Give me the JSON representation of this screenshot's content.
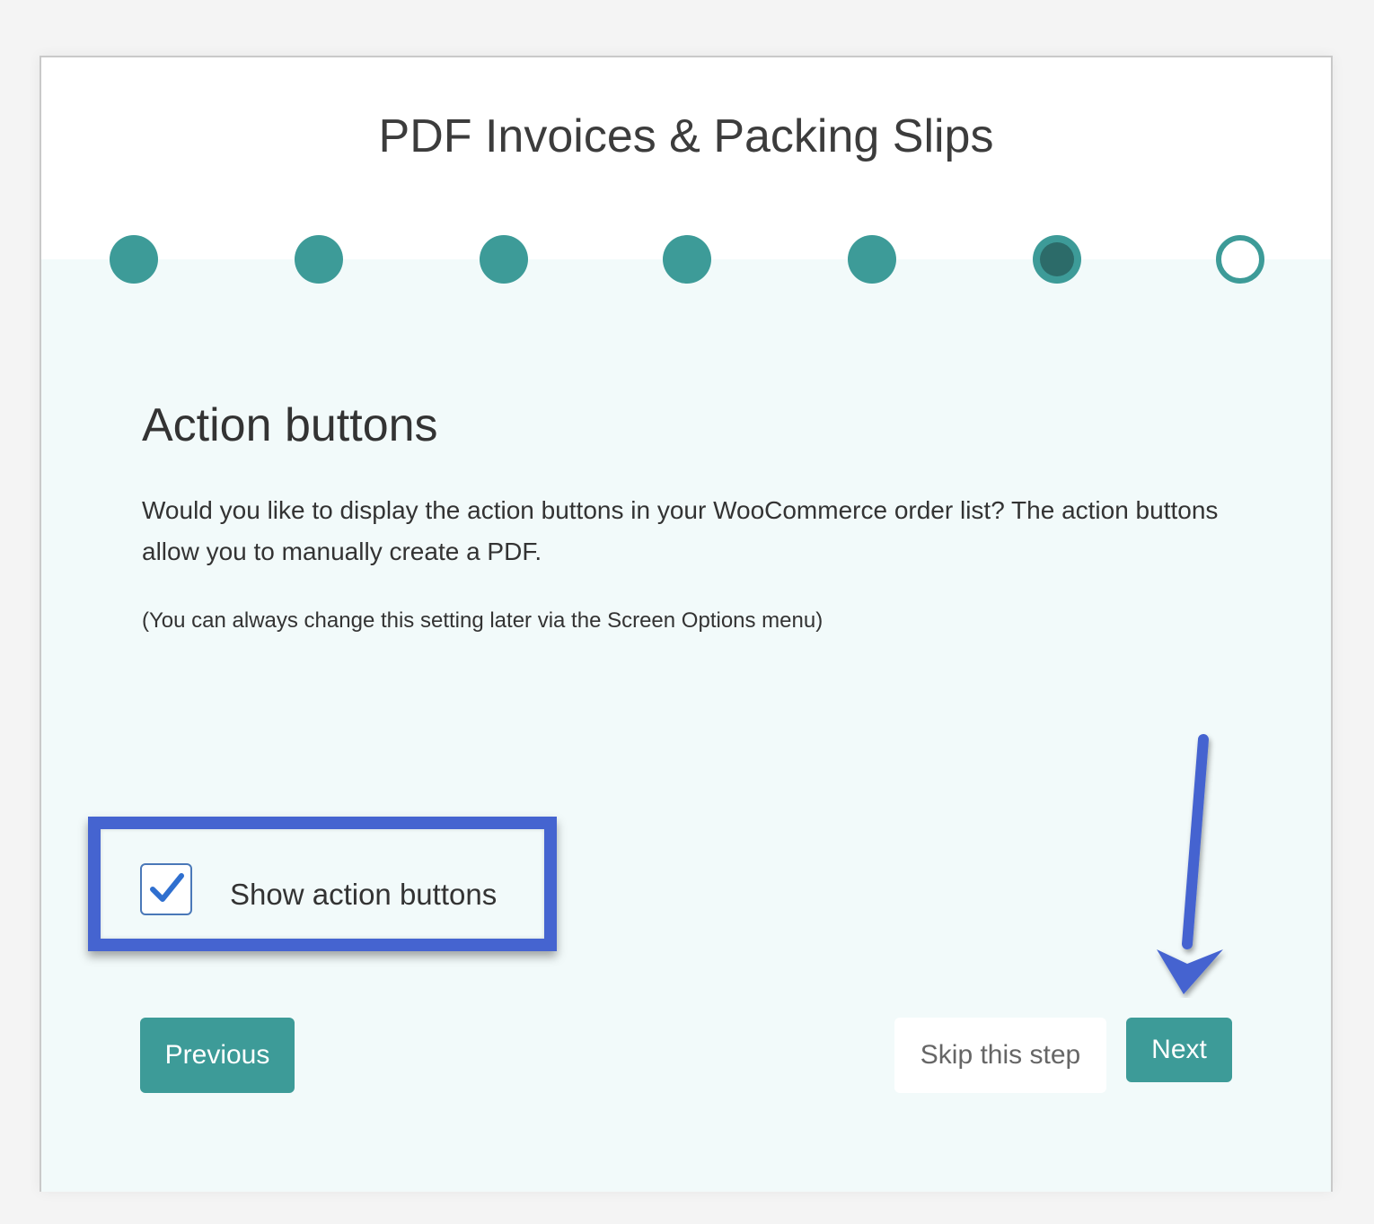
{
  "app": {
    "title": "PDF Invoices & Packing Slips"
  },
  "wizard": {
    "steps": [
      {
        "state": "done"
      },
      {
        "state": "done"
      },
      {
        "state": "done"
      },
      {
        "state": "done"
      },
      {
        "state": "done"
      },
      {
        "state": "current"
      },
      {
        "state": "todo"
      }
    ],
    "current_step": 6,
    "total_steps": 7
  },
  "section": {
    "title": "Action buttons",
    "description": "Would you like to display the action buttons in your WooCommerce order list? The action buttons allow you to manually create a PDF.",
    "note": "(You can always change this setting later via the Screen Options menu)"
  },
  "option": {
    "label": "Show action buttons",
    "checked": true
  },
  "buttons": {
    "previous": "Previous",
    "skip": "Skip this step",
    "next": "Next"
  },
  "colors": {
    "accent": "#3d9b98",
    "accent_dark": "#2c6b69",
    "annotation": "#4564d0",
    "body_bg": "#f2fafa"
  }
}
